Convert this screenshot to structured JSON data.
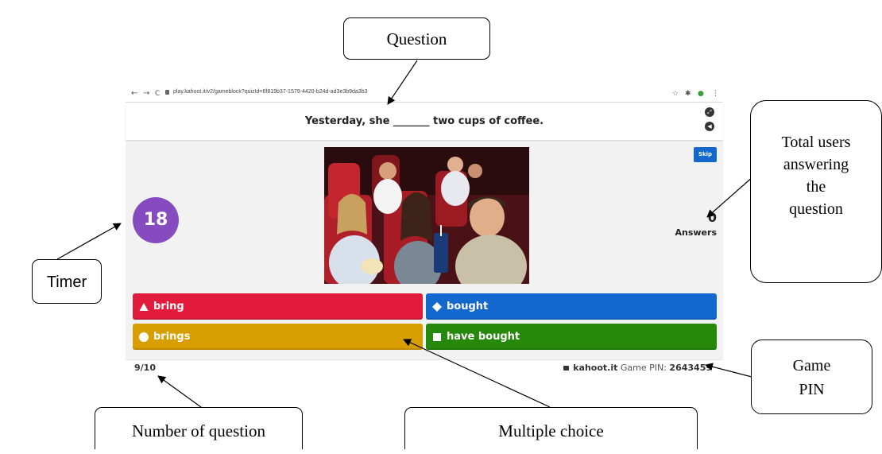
{
  "browser": {
    "url": "play.kahoot.it/v2/gameblock?quizId=6f819b37-1579-4420-b24d-ad3e3b9da3b3",
    "nav_back": "←",
    "nav_forward": "→",
    "nav_reload": "C"
  },
  "question": {
    "text": "Yesterday, she _______ two cups of coffee."
  },
  "timer": {
    "value": "18"
  },
  "skip_label": "Skip",
  "answers": {
    "count": "0",
    "label": "Answers"
  },
  "choices": [
    {
      "label": "bring",
      "color": "#e21b3c",
      "shape": "triangle"
    },
    {
      "label": "bought",
      "color": "#1368ce",
      "shape": "diamond"
    },
    {
      "label": "brings",
      "color": "#d89e00",
      "shape": "circle"
    },
    {
      "label": "have bought",
      "color": "#26890c",
      "shape": "square"
    }
  ],
  "footer": {
    "question_number": "9/10",
    "site": "kahoot.it",
    "pin_label": "Game PIN:",
    "pin_value": "2643459"
  },
  "annotations": {
    "question": "Question",
    "total_users": [
      "Total users",
      "answering",
      "the",
      "question"
    ],
    "timer": "Timer",
    "game_pin": [
      "Game",
      "PIN"
    ],
    "number_of_question": "Number of question",
    "multiple_choice": "Multiple choice"
  }
}
